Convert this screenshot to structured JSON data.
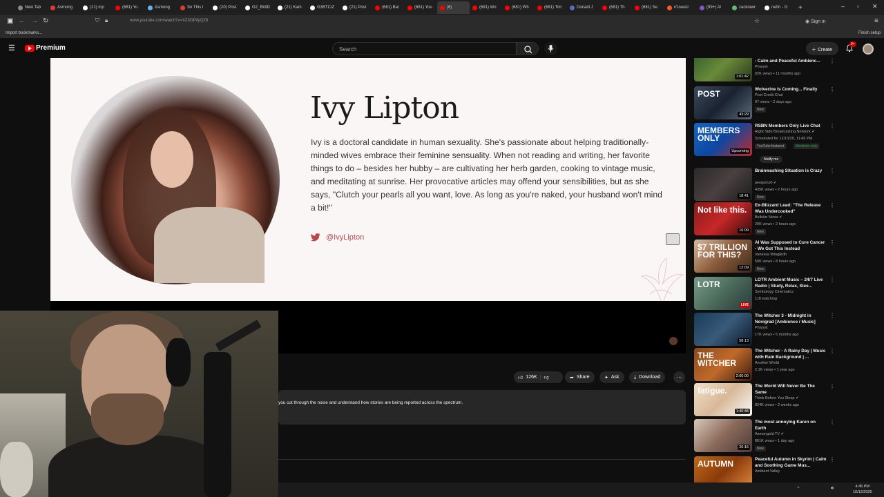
{
  "browser": {
    "tabs": [
      {
        "label": "New Tab",
        "color": "#888888"
      },
      {
        "label": "Asmong",
        "color": "#e53935"
      },
      {
        "label": "(21) mp",
        "color": "#ffffff"
      },
      {
        "label": "(681) Yo",
        "color": "#ff0000"
      },
      {
        "label": "Asmong",
        "color": "#64b5f6"
      },
      {
        "label": "So This I",
        "color": "#e53935"
      },
      {
        "label": "(20) Post",
        "color": "#ffffff"
      },
      {
        "label": "G2_Bk9D",
        "color": "#ffffff"
      },
      {
        "label": "(21) Kam",
        "color": "#ffffff"
      },
      {
        "label": "G3BTCiZ",
        "color": "#ffffff"
      },
      {
        "label": "(21) Post",
        "color": "#ffffff"
      },
      {
        "label": "(681) Bal",
        "color": "#ff0000"
      },
      {
        "label": "(681) You",
        "color": "#ff0000"
      },
      {
        "label": "(6)",
        "color": "#ff0000"
      },
      {
        "label": "(681) Wo",
        "color": "#ff0000"
      },
      {
        "label": "(681) Wh",
        "color": "#ff0000"
      },
      {
        "label": "(681) Tim",
        "color": "#ff0000"
      },
      {
        "label": "Donald J",
        "color": "#5c6bc0"
      },
      {
        "label": "(681) Th",
        "color": "#ff0000"
      },
      {
        "label": "(681) Se",
        "color": "#ff0000"
      },
      {
        "label": "r/Livestr",
        "color": "#ff5722"
      },
      {
        "label": "(99+) Al",
        "color": "#7e57c2"
      },
      {
        "label": "zackrawr",
        "color": "#66bb6a"
      },
      {
        "label": "ne0n - G",
        "color": "#ffffff"
      }
    ],
    "active_tab_index": 13,
    "url": "www.youtube.com/watch?v=XZ3OPifyQZ8",
    "bookmarks": {
      "import": "Import bookmarks...",
      "finish": "Finish setup"
    },
    "signin": "Sign in"
  },
  "youtube": {
    "logo_text": "Premium",
    "search_placeholder": "Search",
    "create_label": "Create",
    "notification_count": "9+"
  },
  "video": {
    "author_name": "Ivy Lipton",
    "author_bio": "Ivy is a doctoral candidate in human sexuality. She's passionate about helping traditionally-minded wives embrace their feminine sensuality. When not reading and writing, her favorite things to do – besides her hubby – are cultivating her herb garden, cooking to vintage music, and meditating at sunrise. Her provocative articles may offend your sensibilities, but as she says, \"Clutch your pearls all you want, love. As long as you're naked, your husband won't mind a bit!\"",
    "twitter_handle": "@IvyLipton"
  },
  "actions": {
    "likes": "126K",
    "share": "Share",
    "ask": "Ask",
    "download": "Download"
  },
  "description_text": "you cut through the noise and understand how stories are being reported across the spectrum.",
  "sidebar": [
    {
      "title": "- Calm and Peaceful Ambienc...",
      "channel": "Pharyst",
      "meta": "92K views • 11 months ago",
      "badge": "",
      "duration": "1:01:42",
      "thumb_text": "",
      "thumb_bg": "linear-gradient(135deg,#2d5a2a,#6a8a3a,#2a3a1a)",
      "verified": false
    },
    {
      "title": "Wolverine Is Coming... Finally",
      "channel": "Post Credit Chat",
      "meta": "97 views • 2 days ago",
      "badge": "New",
      "duration": "43:29",
      "thumb_text": "POST",
      "thumb_bg": "linear-gradient(135deg,#3a4a5a,#1a2230,#5a6a7a)",
      "verified": false
    },
    {
      "title": "RSBN Members Only Live Chat",
      "channel": "Right Side Broadcasting Network",
      "meta": "Scheduled for 12/13/25, 11:45 PM",
      "badge": "YouTube featured",
      "members": "Members only",
      "duration": "Upcoming",
      "thumb_text": "MEMBERS ONLY",
      "thumb_bg": "linear-gradient(135deg,#1565c0,#0d47a1,#c62828)",
      "notify": "Notify me",
      "verified": true
    },
    {
      "title": "Brainwashing Situation is Crazy",
      "channel": "penguinz0",
      "meta": "435K views • 2 hours ago",
      "badge": "New",
      "duration": "18:41",
      "thumb_text": "",
      "thumb_bg": "linear-gradient(135deg,#2a2a2a,#4a4040,#1a1a1a)",
      "verified": true
    },
    {
      "title": "Ex-Blizzard Lead: \"The Release Was Undercooked\"",
      "channel": "Bellular News",
      "meta": "20K views • 2 hours ago",
      "badge": "New",
      "duration": "16:09",
      "thumb_text": "Not like this.",
      "thumb_bg": "linear-gradient(135deg,#8b1a1a,#c62828,#3a0a0a)",
      "verified": true
    },
    {
      "title": "AI Was Supposed to Cure Cancer - We Got This Instead",
      "channel": "Vanessa Wingårdh",
      "meta": "50K views • 8 hours ago",
      "badge": "New",
      "duration": "12:09",
      "thumb_text": "$7 TRILLION FOR THIS?",
      "thumb_bg": "linear-gradient(135deg,#d8b89a,#8a5a3a,#3a2a1a)",
      "verified": false
    },
    {
      "title": "LOTR Ambient Music – 24/7 Live Radio | Study, Relax, Slee...",
      "channel": "Symbology Cinematics",
      "meta": "118 watching",
      "badge": "",
      "duration": "LIVE",
      "thumb_text": "LOTR",
      "thumb_bg": "linear-gradient(135deg,#7a9a8a,#4a6a5a,#2a3a3a)",
      "verified": false
    },
    {
      "title": "The Witcher 3 - Midnight in Novigrad [Ambience / Music]",
      "channel": "Pharyst",
      "meta": "17K views • 5 months ago",
      "badge": "",
      "duration": "58:13",
      "thumb_text": "",
      "thumb_bg": "linear-gradient(135deg,#1a3a5a,#3a5a7a,#0a1a2a)",
      "verified": false
    },
    {
      "title": "The Witcher - A Rainy Day | Music with Rain Background | ...",
      "channel": "Another World",
      "meta": "2.1K views • 1 year ago",
      "badge": "",
      "duration": "2:00:00",
      "thumb_text": "THE WITCHER",
      "thumb_bg": "linear-gradient(135deg,#8a4a1a,#c06a2a,#3a1a0a)",
      "verified": false
    },
    {
      "title": "The World Will Never Be The Same",
      "channel": "Think Before You Sleep",
      "meta": "824K views • 2 weeks ago",
      "badge": "",
      "duration": "1:40:48",
      "thumb_text": "fatigue.",
      "thumb_bg": "linear-gradient(135deg,#f0e0c8,#d8b898,#fafafa)",
      "verified": true
    },
    {
      "title": "The most annoying Karen on Earth",
      "channel": "Asmongold TV",
      "meta": "801K views • 1 day ago",
      "badge": "New",
      "duration": "26:16",
      "thumb_text": "",
      "thumb_bg": "linear-gradient(135deg,#d8c8b8,#8a6a5a,#4a3a3a)",
      "verified": true
    },
    {
      "title": "Peaceful Autumn in Skyrim | Calm and Soothing Game Mus...",
      "channel": "Ambient Valley",
      "meta": "",
      "badge": "",
      "duration": "",
      "thumb_text": "AUTUMN",
      "thumb_bg": "linear-gradient(135deg,#c06a1a,#8a3a0a,#e08a3a)",
      "verified": false
    }
  ],
  "taskbar": {
    "time": "4:45 PM",
    "date": "10/12/2025"
  }
}
